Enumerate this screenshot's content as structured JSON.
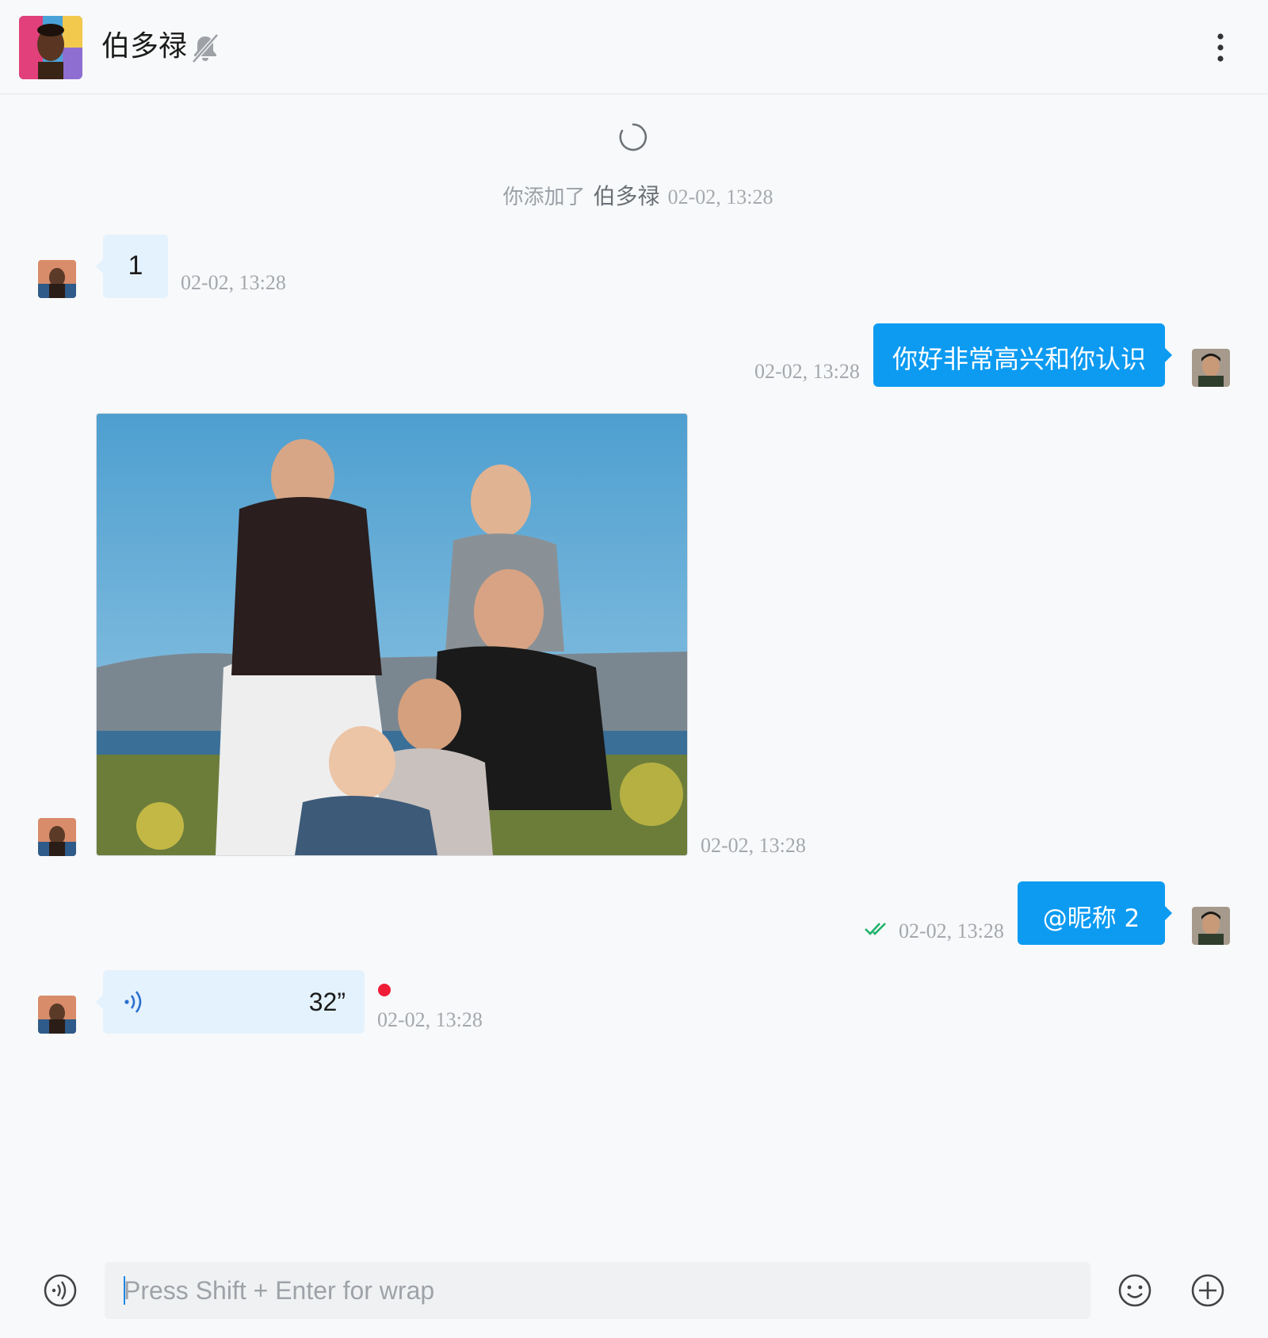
{
  "header": {
    "title": "伯多禄",
    "muted": true
  },
  "system_message": {
    "prefix": "你添加了",
    "name": "伯多禄",
    "time": "02-02, 13:28"
  },
  "messages": [
    {
      "direction": "incoming",
      "type": "text",
      "text": "1",
      "time": "02-02, 13:28"
    },
    {
      "direction": "outgoing",
      "type": "text",
      "text": "你好非常高兴和你认识",
      "time": "02-02, 13:28"
    },
    {
      "direction": "incoming",
      "type": "image",
      "alt": "family photo",
      "time": "02-02, 13:28"
    },
    {
      "direction": "outgoing",
      "type": "text",
      "text": "@昵称 2",
      "time": "02-02, 13:28",
      "read": true
    },
    {
      "direction": "incoming",
      "type": "voice",
      "duration": "32”",
      "time": "02-02, 13:28",
      "unplayed": true
    }
  ],
  "composer": {
    "placeholder": "Press Shift + Enter for wrap"
  },
  "colors": {
    "accent": "#0d9bf2",
    "incoming_bubble": "#e4f2fd",
    "read_check": "#20b26b",
    "unread_dot": "#ef1d36"
  },
  "icons": [
    "mute-bell-icon",
    "more-vertical-icon",
    "loading-spinner-icon",
    "double-check-icon",
    "voice-wave-icon",
    "voice-input-icon",
    "emoji-icon",
    "add-circle-icon"
  ]
}
